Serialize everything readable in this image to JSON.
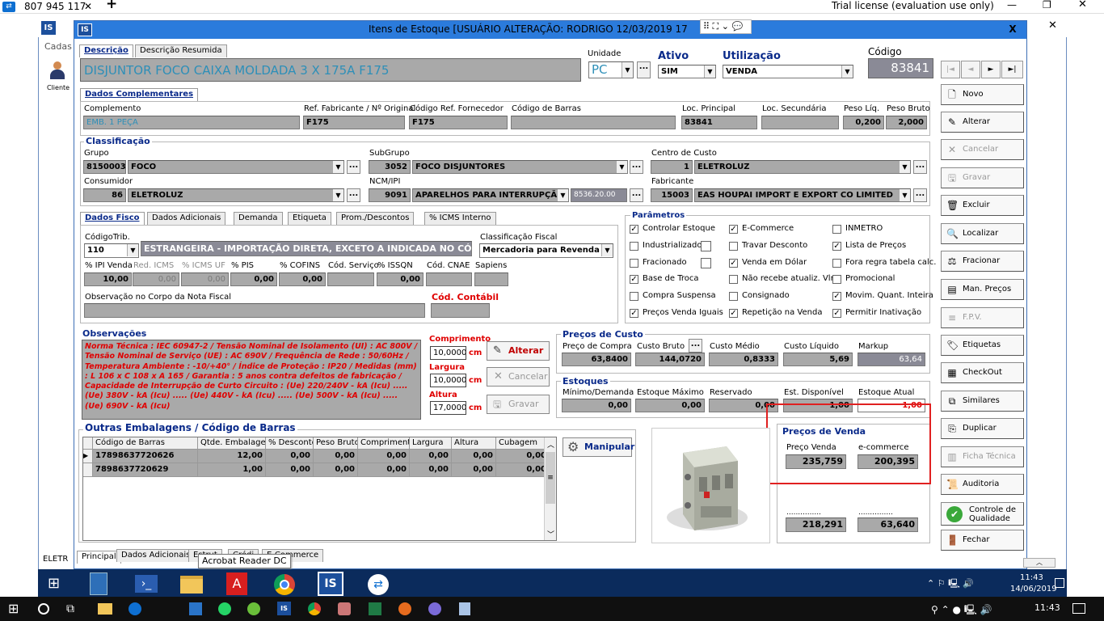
{
  "remote_bar": {
    "session_id": "807 945 117",
    "add": "+",
    "license": "Trial license (evaluation use only)"
  },
  "bg_app": {
    "title_tab": "Cadas",
    "client": "Cliente",
    "bottom_text": "ELETR"
  },
  "window": {
    "logo": "IS",
    "title": "Itens de Estoque  [USUÁRIO ALTERAÇÃO: RODRIGO 12/03/2019 17",
    "close": "X"
  },
  "desc_tabs": [
    "Descrição",
    "Descrição Resumida"
  ],
  "description": "DISJUNTOR FOCO CAIXA MOLDADA 3 X 175A   F175",
  "unidade": {
    "label": "Unidade",
    "value": "PC"
  },
  "ativo": {
    "label": "Ativo",
    "value": "SIM"
  },
  "utilizacao": {
    "label": "Utilização",
    "value": "VENDA"
  },
  "codigo": {
    "label": "Código",
    "value": "83841"
  },
  "nav": [
    "|◄",
    "◄",
    "►",
    "►|"
  ],
  "dados_compl": {
    "tab": "Dados Complementares",
    "complemento": {
      "label": "Complemento",
      "value": "EMB. 1 PEÇA"
    },
    "ref_fab": {
      "label": "Ref. Fabricante / Nº Original",
      "value": "F175"
    },
    "cod_forn": {
      "label": "Código Ref. Fornecedor",
      "value": "F175"
    },
    "cod_barras": {
      "label": "Código de Barras",
      "value": ""
    },
    "loc_principal": {
      "label": "Loc. Principal",
      "value": "83841"
    },
    "loc_sec": {
      "label": "Loc. Secundária",
      "value": ""
    },
    "peso_liq": {
      "label": "Peso Líq.",
      "value": "0,200"
    },
    "peso_bruto": {
      "label": "Peso Bruto",
      "value": "2,000"
    }
  },
  "classificacao": {
    "title": "Classificação",
    "grupo": {
      "label": "Grupo",
      "code": "8150003",
      "name": "FOCO"
    },
    "subgrupo": {
      "label": "SubGrupo",
      "code": "3052",
      "name": "FOCO DISJUNTORES"
    },
    "centro": {
      "label": "Centro de Custo",
      "code": "1",
      "name": "ELETROLUZ"
    },
    "consumidor": {
      "label": "Consumidor",
      "code": "86",
      "name": "ELETROLUZ"
    },
    "ncm": {
      "label": "NCM/IPI",
      "code": "9091",
      "name": "APARELHOS PARA INTERRUPÇÃO,",
      "extra": "8536.20.00"
    },
    "fabricante": {
      "label": "Fabricante",
      "code": "15003",
      "name": "EAS HOUPAI IMPORT E EXPORT CO LIMITED"
    }
  },
  "fiscal_tabs": [
    "Dados Fisco",
    "Dados Adicionais",
    "Demanda",
    "Etiqueta",
    "Prom./Descontos",
    "% ICMS Interno"
  ],
  "fisco": {
    "codtrib": {
      "label": "CódigoTrib.",
      "value": "110",
      "desc": "ESTRANGEIRA - IMPORTAÇÃO DIRETA, EXCETO A INDICADA NO CÓDIGO"
    },
    "class_fiscal": {
      "label": "Classificação Fiscal",
      "value": "Mercadoria para Revenda"
    },
    "ipi": {
      "label": "% IPI Venda",
      "value": "10,00"
    },
    "red_icms": {
      "label": "Red. ICMS",
      "value": "0,00"
    },
    "icms_uf": {
      "label": "% ICMS UF",
      "value": "0,00"
    },
    "pis": {
      "label": "% PIS",
      "value": "0,00"
    },
    "cofins": {
      "label": "% COFINS",
      "value": "0,00"
    },
    "cod_servico": {
      "label": "Cód. Serviço",
      "value": ""
    },
    "issqn": {
      "label": "% ISSQN",
      "value": "0,00"
    },
    "cnae": {
      "label": "Cód. CNAE",
      "value": ""
    },
    "sapiens": {
      "label": "Sapiens",
      "value": ""
    },
    "obs_nota": {
      "label": "Observação no Corpo da Nota Fiscal",
      "value": ""
    },
    "cod_contabil": {
      "label": "Cód. Contábil",
      "value": ""
    }
  },
  "parametros": {
    "title": "Parâmetros",
    "items": [
      {
        "label": "Controlar Estoque",
        "checked": true
      },
      {
        "label": "E-Commerce",
        "checked": true
      },
      {
        "label": "INMETRO",
        "checked": false
      },
      {
        "label": "Industrializado",
        "checked": false
      },
      {
        "label": "Travar Desconto",
        "checked": false
      },
      {
        "label": "Lista de Preços",
        "checked": true
      },
      {
        "label": "Fracionado",
        "checked": false
      },
      {
        "label": "Venda em Dólar",
        "checked": true
      },
      {
        "label": "Fora regra tabela calc.",
        "checked": false
      },
      {
        "label": "Base de Troca",
        "checked": true
      },
      {
        "label": "Não recebe atualiz. Vlr",
        "checked": false
      },
      {
        "label": "Promocional",
        "checked": false
      },
      {
        "label": "Compra Suspensa",
        "checked": false
      },
      {
        "label": "Consignado",
        "checked": false
      },
      {
        "label": "Movim. Quant. Inteira",
        "checked": true
      },
      {
        "label": "Preços Venda Iguais",
        "checked": true
      },
      {
        "label": "Repetição na Venda",
        "checked": true
      },
      {
        "label": "Permitir Inativação",
        "checked": true
      }
    ]
  },
  "observacoes": {
    "title": "Observações",
    "text": "Norma Técnica : IEC 60947-2 / Tensão Nominal de Isolamento (UI) : AC 800V / Tensão Nominal de Serviço (UE) : AC 690V / Frequência de Rede : 50/60Hz / Temperatura Ambiente : -10/+40° / Índice de Proteção : IP20 / Medidas (mm) : L 106 x C 108 x A 165 / Garantia : 5 anos contra defeitos de fabricação / Capacidade de Interrupção de Curto Circuito : (Ue) 220/240V - kA (Icu) ..... (Ue) 380V - kA (Icu) ..... (Ue) 440V - kA (Icu) ..... (Ue) 500V - kA (Icu) ..... (Ue) 690V - kA (Icu)"
  },
  "dims": {
    "comprimento": {
      "label": "Comprimento",
      "value": "10,0000",
      "unit": "cm"
    },
    "largura": {
      "label": "Largura",
      "value": "10,0000",
      "unit": "cm"
    },
    "altura": {
      "label": "Altura",
      "value": "17,0000",
      "unit": "cm"
    },
    "alterar": "Alterar",
    "cancelar": "Cancelar",
    "gravar": "Gravar"
  },
  "custo": {
    "title": "Preços de Custo",
    "compra": {
      "label": "Preço de Compra",
      "value": "63,8400"
    },
    "bruto": {
      "label": "Custo Bruto",
      "value": "144,0720"
    },
    "medio": {
      "label": "Custo Médio",
      "value": "0,8333"
    },
    "liquido": {
      "label": "Custo Líquido",
      "value": "5,69"
    },
    "markup": {
      "label": "Markup",
      "value": "63,64"
    }
  },
  "estoques": {
    "title": "Estoques",
    "minimo": {
      "label": "Mínimo/Demanda",
      "value": "0,00"
    },
    "maximo": {
      "label": "Estoque Máximo",
      "value": "0,00"
    },
    "reservado": {
      "label": "Reservado",
      "value": "0,00"
    },
    "disponivel": {
      "label": "Est. Disponível",
      "value": "1,00"
    },
    "atual": {
      "label": "Estoque Atual",
      "value": "1,00"
    }
  },
  "precos_venda": {
    "title": "Preços de Venda",
    "venda": {
      "label": "Preço Venda",
      "value": "235,759"
    },
    "ecommerce": {
      "label": "e-commerce",
      "value": "200,395"
    },
    "extra1": {
      "label": "...............",
      "value": "218,291"
    },
    "extra2": {
      "label": "...............",
      "value": "63,640"
    }
  },
  "embalagens": {
    "title": "Outras Embalagens / Código de Barras",
    "columns": [
      "Código de Barras",
      "Qtde. Embalagem",
      "% Desconto",
      "Peso Bruto",
      "Comprimento",
      "Largura",
      "Altura",
      "Cubagem"
    ],
    "rows": [
      [
        "17898637720626",
        "12,00",
        "0,00",
        "0,00",
        "0,00",
        "0,00",
        "0,00",
        "0,00"
      ],
      [
        "7898637720629",
        "1,00",
        "0,00",
        "0,00",
        "0,00",
        "0,00",
        "0,00",
        "0,00"
      ]
    ],
    "manipular": "Manipular"
  },
  "side_buttons": [
    "Novo",
    "Alterar",
    "Cancelar",
    "Gravar",
    "Excluir",
    "Localizar",
    "Fracionar",
    "Man. Preços",
    "F.P.V.",
    "Etiquetas",
    "CheckOut",
    "Similares",
    "Duplicar",
    "Ficha Técnica",
    "Auditoria",
    "Controle de Qualidade",
    "Fechar"
  ],
  "bottom_tabs": [
    "Principal",
    "Dados Adicionais",
    "Estrut",
    "Crédi",
    "E-Commerce"
  ],
  "tooltip": "Acrobat Reader DC",
  "inner_taskbar": {
    "time": "11:43",
    "date": "14/06/2019"
  },
  "taskbar": {
    "time": "11:43"
  }
}
